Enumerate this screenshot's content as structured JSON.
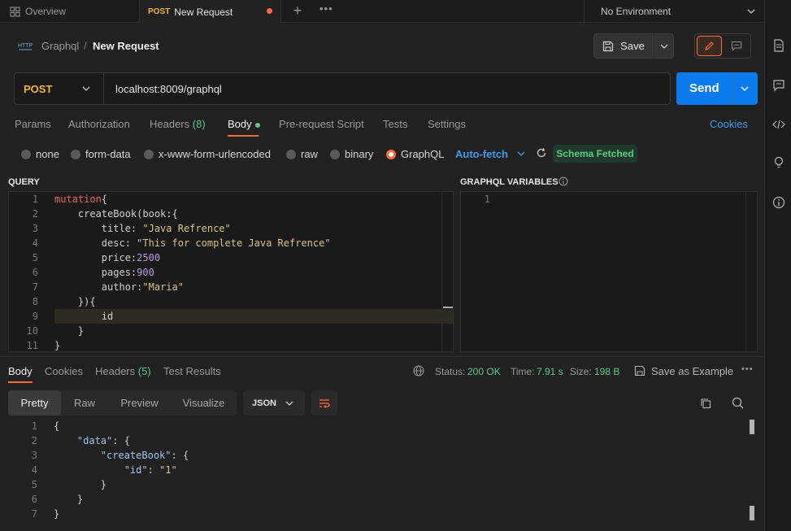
{
  "tabs": {
    "overview": "Overview",
    "active_method": "POST",
    "active_title": "New Request",
    "environment": "No Environment"
  },
  "breadcrumb": {
    "collection": "Graphql",
    "separator": "/",
    "request": "New Request"
  },
  "toolbar": {
    "save_label": "Save"
  },
  "request": {
    "method": "POST",
    "url": "localhost:8009/graphql",
    "send_label": "Send"
  },
  "request_tabs": {
    "params": "Params",
    "authorization": "Authorization",
    "headers": "Headers",
    "headers_count": "(8)",
    "body": "Body",
    "pre_request": "Pre-request Script",
    "tests": "Tests",
    "settings": "Settings",
    "cookies": "Cookies"
  },
  "body_types": {
    "none": "none",
    "form_data": "form-data",
    "urlencoded": "x-www-form-urlencoded",
    "raw": "raw",
    "binary": "binary",
    "graphql": "GraphQL",
    "auto_fetch": "Auto-fetch",
    "schema_badge": "Schema Fetched"
  },
  "query_panel": {
    "title": "QUERY",
    "lines": [
      "mutation{",
      "    createBook(book:{",
      "        title: \"Java Refrence\"",
      "        desc: \"This for complete Java Refrence\"",
      "        price:2500",
      "        pages:900",
      "        author:\"Maria\"",
      "    }){",
      "        id",
      "    }",
      "}"
    ]
  },
  "variables_panel": {
    "title": "GRAPHQL VARIABLES",
    "lines": [
      ""
    ]
  },
  "response": {
    "tabs": {
      "body": "Body",
      "cookies": "Cookies",
      "headers": "Headers",
      "headers_count": "(5)",
      "test_results": "Test Results"
    },
    "status_label": "Status:",
    "status_value": "200 OK",
    "time_label": "Time:",
    "time_value": "7.91 s",
    "size_label": "Size:",
    "size_value": "198 B",
    "save_example": "Save as Example",
    "view_modes": {
      "pretty": "Pretty",
      "raw": "Raw",
      "preview": "Preview",
      "visualize": "Visualize"
    },
    "format": "JSON",
    "lines": [
      "{",
      "    \"data\": {",
      "        \"createBook\": {",
      "            \"id\": \"1\"",
      "        }",
      "    }",
      "}"
    ]
  },
  "colors": {
    "accent": "#ff6c37",
    "send": "#097bed",
    "success": "#5cc98a",
    "link": "#3d9ae8"
  }
}
